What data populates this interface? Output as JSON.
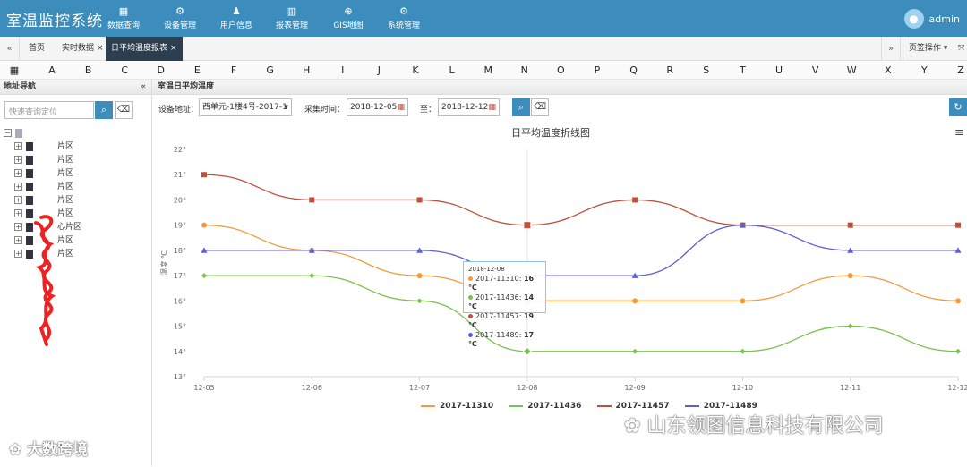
{
  "header": {
    "app_title": "室温监控系统",
    "nav": [
      {
        "label": "数据查询",
        "icon": "grid-icon"
      },
      {
        "label": "设备管理",
        "icon": "gears-icon"
      },
      {
        "label": "用户信息",
        "icon": "user-icon"
      },
      {
        "label": "报表管理",
        "icon": "bar-chart-icon"
      },
      {
        "label": "GIS地图",
        "icon": "globe-icon"
      },
      {
        "label": "系统管理",
        "icon": "gears-icon"
      }
    ],
    "username": "admin"
  },
  "tabs": [
    {
      "label": "首页",
      "closable": false,
      "active": false
    },
    {
      "label": "实时数据",
      "closable": true,
      "active": false
    },
    {
      "label": "日平均温度报表",
      "closable": true,
      "active": true
    }
  ],
  "tab_actions": {
    "page_ops": "页签操作"
  },
  "column_letters": [
    "A",
    "B",
    "C",
    "D",
    "E",
    "F",
    "G",
    "H",
    "I",
    "J",
    "K",
    "L",
    "M",
    "N",
    "O",
    "P",
    "Q",
    "R",
    "S",
    "T",
    "U",
    "V",
    "W",
    "X",
    "Y",
    "Z"
  ],
  "sidebar": {
    "title": "地址导航",
    "search_placeholder": "快速查询定位",
    "tree": [
      "片区",
      "片区",
      "片区",
      "片区",
      "片区",
      "片区",
      "心片区",
      "片区",
      "片区"
    ]
  },
  "main": {
    "title": "室温日平均温度",
    "filters": {
      "device_label": "设备地址：",
      "device_value": "西单元-1楼4号-2017-1",
      "time_label": "采集时间：",
      "start_date": "2018-12-05",
      "to_label": "至：",
      "end_date": "2018-12-12"
    }
  },
  "chart_data": {
    "type": "line",
    "title": "日平均温度折线图",
    "ylabel": "温度 ℃",
    "x": [
      "12-05",
      "12-06",
      "12-07",
      "12-08",
      "12-09",
      "12-10",
      "12-11",
      "12-12"
    ],
    "y_ticks": [
      "22°",
      "21°",
      "20°",
      "19°",
      "18°",
      "17°",
      "16°",
      "15°",
      "14°",
      "13°"
    ],
    "ylim": [
      13,
      22
    ],
    "grid": false,
    "legend_position": "bottom",
    "series": [
      {
        "name": "2017-11310",
        "color": "#f39c3e",
        "marker": "circle",
        "values": [
          19,
          18,
          17,
          16,
          16,
          16,
          17,
          16
        ]
      },
      {
        "name": "2017-11436",
        "color": "#7cc14f",
        "marker": "diamond",
        "values": [
          17,
          17,
          16,
          14,
          14,
          14,
          15,
          14
        ]
      },
      {
        "name": "2017-11457",
        "color": "#c0503a",
        "marker": "square",
        "values": [
          21,
          20,
          20,
          19,
          20,
          19,
          19,
          19
        ]
      },
      {
        "name": "2017-11489",
        "color": "#5b5fd6",
        "marker": "triangle",
        "values": [
          18,
          18,
          18,
          17,
          17,
          19,
          18,
          18
        ]
      }
    ],
    "tooltip": {
      "date": "2018-12-08",
      "rows": [
        {
          "name": "2017-11310",
          "value": "16 ℃"
        },
        {
          "name": "2017-11436",
          "value": "14 ℃"
        },
        {
          "name": "2017-11457",
          "value": "19 ℃"
        },
        {
          "name": "2017-11489",
          "value": "17 ℃"
        }
      ]
    }
  },
  "watermarks": {
    "left": "大数跨境",
    "right": "山东领图信息科技有限公司"
  }
}
